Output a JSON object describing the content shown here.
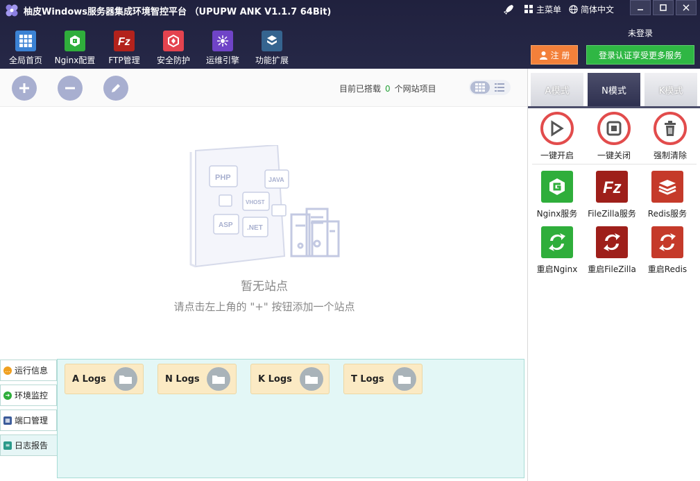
{
  "app": {
    "title": "柚皮Windows服务器集成环境智控平台  （UPUPW ANK V1.1.7 64Bit)",
    "menu_label": "主菜单",
    "language_label": "简体中文"
  },
  "toolbar": [
    {
      "label": "全局首页",
      "icon": "grid-icon",
      "color": "#3b82d4"
    },
    {
      "label": "Nginx配置",
      "icon": "nginx-icon",
      "color": "#2fae3b"
    },
    {
      "label": "FTP管理",
      "icon": "filezilla-icon",
      "color": "#b3221c"
    },
    {
      "label": "安全防护",
      "icon": "shield-icon",
      "color": "#e4434f"
    },
    {
      "label": "运维引擎",
      "icon": "engine-icon",
      "color": "#6f44c7"
    },
    {
      "label": "功能扩展",
      "icon": "extension-icon",
      "color": "#35648f"
    }
  ],
  "account": {
    "status": "未登录",
    "register_label": "注 册",
    "login_label": "登录认证享受更多服务"
  },
  "sites": {
    "count_prefix": "目前已搭载",
    "count": "0",
    "count_suffix": "个网站项目",
    "illustration_labels": [
      "PHP",
      "JAVA",
      "VHOST",
      "ASP",
      ".NET"
    ],
    "empty_title": "暂无站点",
    "empty_hint": "请点击左上角的 \"+\" 按钮添加一个站点"
  },
  "side_tabs": [
    {
      "label": "运行信息",
      "color": "#f0a020"
    },
    {
      "label": "环境监控",
      "color": "#2fae3b"
    },
    {
      "label": "端口管理",
      "color": "#3b5b9a"
    },
    {
      "label": "日志报告",
      "color": "#2a9a8a"
    }
  ],
  "logs": [
    {
      "label": "A Logs"
    },
    {
      "label": "N Logs"
    },
    {
      "label": "K Logs"
    },
    {
      "label": "T Logs"
    }
  ],
  "modes": [
    {
      "label": "A模式"
    },
    {
      "label": "N模式"
    },
    {
      "label": "K模式"
    }
  ],
  "controls": [
    {
      "label": "一键开启",
      "icon": "play-icon"
    },
    {
      "label": "一键关闭",
      "icon": "stop-icon"
    },
    {
      "label": "强制清除",
      "icon": "trash-icon"
    }
  ],
  "services": [
    {
      "label": "Nginx服务",
      "icon": "nginx-icon",
      "color": "#2fae3b"
    },
    {
      "label": "FileZilla服务",
      "icon": "filezilla-icon",
      "color": "#9e1f1a"
    },
    {
      "label": "Redis服务",
      "icon": "redis-icon",
      "color": "#c53a2a"
    }
  ],
  "restarts": [
    {
      "label": "重启Nginx",
      "icon": "restart-nginx-icon",
      "color": "#2fae3b"
    },
    {
      "label": "重启FileZilla",
      "icon": "restart-filezilla-icon",
      "color": "#9e1f1a"
    },
    {
      "label": "重启Redis",
      "icon": "restart-redis-icon",
      "color": "#c53a2a"
    }
  ]
}
